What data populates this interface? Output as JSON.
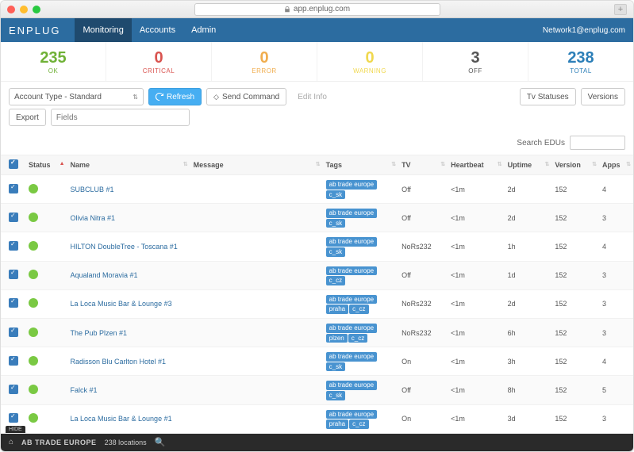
{
  "browser": {
    "url": "app.enplug.com"
  },
  "navbar": {
    "brand": "ENPLUG",
    "links": [
      "Monitoring",
      "Accounts",
      "Admin"
    ],
    "active": 0,
    "user": "Network1@enplug.com"
  },
  "stats": [
    {
      "num": "235",
      "label": "OK",
      "color": "#6fb136"
    },
    {
      "num": "0",
      "label": "CRITICAL",
      "color": "#d9534f"
    },
    {
      "num": "0",
      "label": "ERROR",
      "color": "#f0ad4e"
    },
    {
      "num": "0",
      "label": "WARNING",
      "color": "#f0d84e"
    },
    {
      "num": "3",
      "label": "OFF",
      "color": "#555"
    },
    {
      "num": "238",
      "label": "TOTAL",
      "color": "#2c7fb8"
    }
  ],
  "controls": {
    "account_type": "Account Type - Standard",
    "refresh": "Refresh",
    "send_command": "Send Command",
    "edit_info": "Edit Info",
    "tv_statuses": "Tv Statuses",
    "versions": "Versions",
    "export": "Export",
    "fields_placeholder": "Fields",
    "search_label": "Search EDUs"
  },
  "columns": [
    "",
    "Status",
    "Name",
    "Message",
    "Tags",
    "TV",
    "Heartbeat",
    "Uptime",
    "Version",
    "Apps"
  ],
  "sorted_col": "Status",
  "rows": [
    {
      "name": "SUBCLUB #1",
      "tags": [
        "ab trade europe",
        "c_sk"
      ],
      "tv": "Off",
      "hb": "<1m",
      "up": "2d",
      "ver": "152",
      "apps": "4"
    },
    {
      "name": "Olivia Nitra #1",
      "tags": [
        "ab trade europe",
        "c_sk"
      ],
      "tv": "Off",
      "hb": "<1m",
      "up": "2d",
      "ver": "152",
      "apps": "3"
    },
    {
      "name": "HILTON DoubleTree - Toscana #1",
      "tags": [
        "ab trade europe",
        "c_sk"
      ],
      "tv": "NoRs232",
      "hb": "<1m",
      "up": "1h",
      "ver": "152",
      "apps": "4"
    },
    {
      "name": "Aqualand Moravia #1",
      "tags": [
        "ab trade europe",
        "c_cz"
      ],
      "tv": "Off",
      "hb": "<1m",
      "up": "1d",
      "ver": "152",
      "apps": "3"
    },
    {
      "name": "La Loca Music Bar & Lounge #3",
      "tags": [
        "ab trade europe",
        "praha",
        "c_cz"
      ],
      "tv": "NoRs232",
      "hb": "<1m",
      "up": "2d",
      "ver": "152",
      "apps": "3"
    },
    {
      "name": "The Pub Plzen #1",
      "tags": [
        "ab trade europe",
        "plzen",
        "c_cz"
      ],
      "tv": "NoRs232",
      "hb": "<1m",
      "up": "6h",
      "ver": "152",
      "apps": "3"
    },
    {
      "name": "Radisson Blu Carlton Hotel #1",
      "tags": [
        "ab trade europe",
        "c_sk"
      ],
      "tv": "On",
      "hb": "<1m",
      "up": "3h",
      "ver": "152",
      "apps": "4"
    },
    {
      "name": "Falck #1",
      "tags": [
        "ab trade europe",
        "c_sk"
      ],
      "tv": "Off",
      "hb": "<1m",
      "up": "8h",
      "ver": "152",
      "apps": "5"
    },
    {
      "name": "La Loca Music Bar & Lounge #1",
      "tags": [
        "ab trade europe",
        "praha",
        "c_cz"
      ],
      "tv": "On",
      "hb": "<1m",
      "up": "3d",
      "ver": "152",
      "apps": "3"
    }
  ],
  "footer": {
    "hide": "HIDE",
    "account": "AB TRADE EUROPE",
    "locations": "238 locations"
  }
}
